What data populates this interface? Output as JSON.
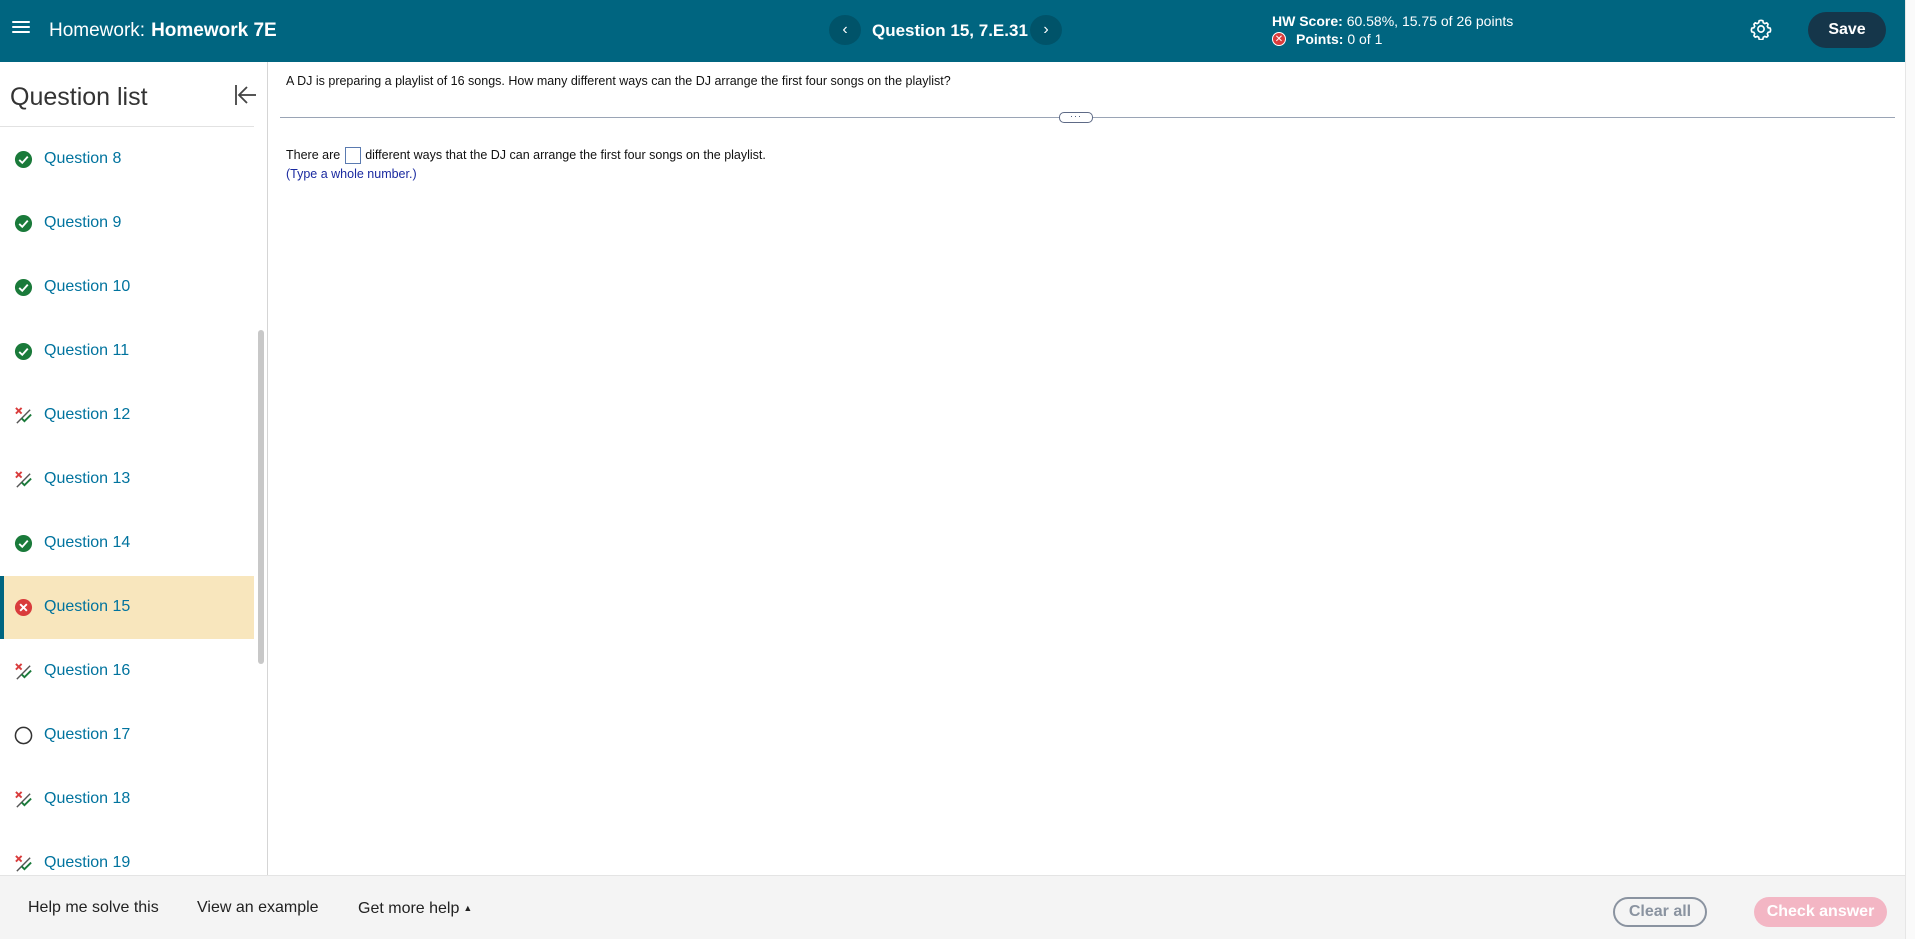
{
  "header": {
    "title_prefix": "Homework:",
    "title_name": "Homework 7E",
    "prev_glyph": "‹",
    "next_glyph": "›",
    "question_title": "Question 15, 7.E.31",
    "hw_score_label": "HW Score:",
    "hw_score_value": "60.58%, 15.75 of 26 points",
    "points_label": "Points:",
    "points_value": "0 of 1",
    "save_label": "Save"
  },
  "sidebar": {
    "heading": "Question list",
    "items": [
      {
        "label": "Question 8",
        "status": "correct"
      },
      {
        "label": "Question 9",
        "status": "correct"
      },
      {
        "label": "Question 10",
        "status": "correct"
      },
      {
        "label": "Question 11",
        "status": "correct"
      },
      {
        "label": "Question 12",
        "status": "partial"
      },
      {
        "label": "Question 13",
        "status": "partial"
      },
      {
        "label": "Question 14",
        "status": "correct"
      },
      {
        "label": "Question 15",
        "status": "incorrect",
        "active": true
      },
      {
        "label": "Question 16",
        "status": "partial"
      },
      {
        "label": "Question 17",
        "status": "unanswered"
      },
      {
        "label": "Question 18",
        "status": "partial"
      },
      {
        "label": "Question 19",
        "status": "partial"
      }
    ]
  },
  "question": {
    "text": "A DJ is preparing a playlist of 16 songs. How many different ways can the DJ arrange the first four songs on the playlist?",
    "divider_handle": "···",
    "answer_prefix": "There are",
    "answer_suffix": "different ways that the DJ can arrange the first four songs on the playlist.",
    "answer_value": "",
    "hint": "(Type a whole number.)"
  },
  "footer": {
    "help_solve": "Help me solve this",
    "view_example": "View an example",
    "more_help": "Get more help",
    "more_help_caret": "▲",
    "clear_all": "Clear all",
    "check_answer": "Check answer"
  },
  "colors": {
    "header_bg": "#006580",
    "link": "#00739e",
    "correct": "#1a7a3a",
    "incorrect": "#d93c3c",
    "active_bg": "#f8e6bd",
    "save_bg": "#15364a",
    "check_disabled": "#f3b6c4"
  },
  "icons": {
    "menu": "hamburger-icon",
    "prev": "chevron-left-icon",
    "next": "chevron-right-icon",
    "settings": "gear-icon",
    "collapse": "collapse-panel-icon",
    "correct": "check-circle-icon",
    "incorrect": "x-circle-icon",
    "partial": "partial-credit-icon",
    "unanswered": "empty-circle-icon"
  }
}
